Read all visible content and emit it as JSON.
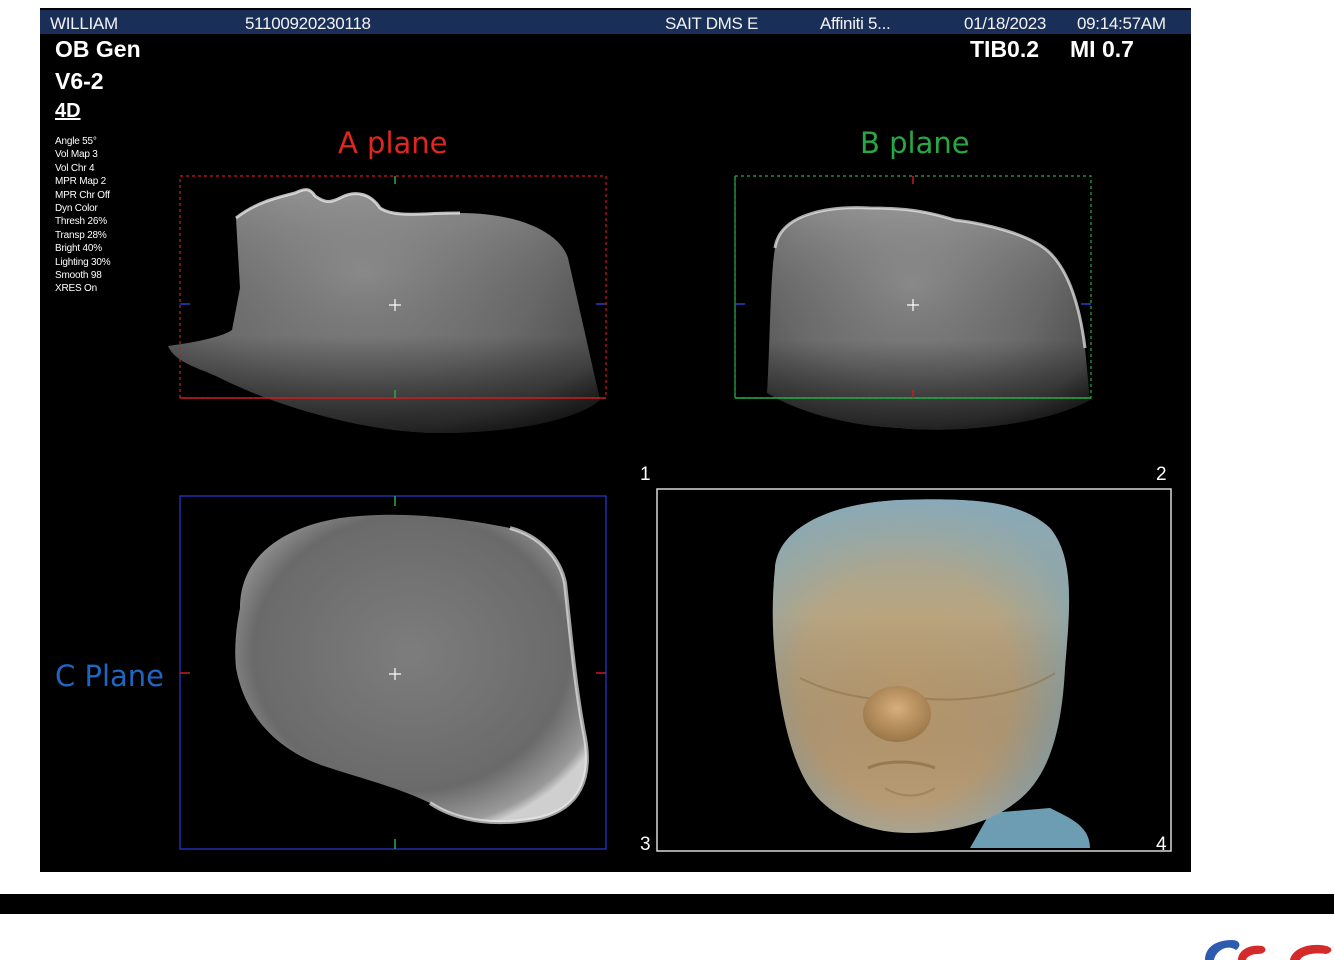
{
  "header": {
    "patient": "WILLIAM",
    "patient_id": "51100920230118",
    "institution": "SAIT DMS E",
    "system": "Affiniti 5...",
    "date": "01/18/2023",
    "time": "09:14:57AM"
  },
  "exam": {
    "preset": "OB Gen",
    "probe": "V6-2",
    "mode": "4D",
    "tib": "TIB0.2",
    "mi": "MI 0.7"
  },
  "settings": [
    "Angle 55°",
    "Vol Map 3",
    "Vol Chr  4",
    "MPR Map 2",
    "MPR Chr Off",
    "Dyn Color",
    "Thresh 26%",
    "Transp 28%",
    "Bright 40%",
    "Lighting 30%",
    "Smooth 98",
    "XRES On"
  ],
  "planes": {
    "a": "A plane",
    "b": "B plane",
    "c": "C Plane"
  },
  "quadrant_numbers": [
    "1",
    "2",
    "3",
    "4"
  ],
  "colors": {
    "header_bar": "#1a2f57",
    "a_plane": "#e0261f",
    "b_plane": "#29a745",
    "c_plane": "#1f66c4",
    "render_skin": "#c9a878"
  }
}
